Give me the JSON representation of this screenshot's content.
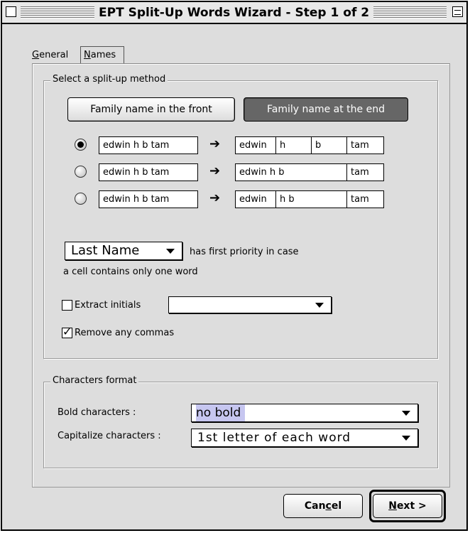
{
  "window": {
    "title": "EPT Split-Up Words Wizard - Step 1 of 2"
  },
  "tabs": [
    {
      "label_prefix": "",
      "mnemonic": "G",
      "label_rest": "eneral"
    },
    {
      "label_prefix": "",
      "mnemonic": "N",
      "label_rest": "ames"
    }
  ],
  "split_method": {
    "legend": "Select a split-up method",
    "btn_front": "Family name in the front",
    "btn_end": "Family name at the end",
    "options": [
      {
        "input": "edwin h b tam",
        "parts": [
          "edwin",
          "h",
          "b",
          "tam"
        ],
        "selected": true
      },
      {
        "input": "edwin h b tam",
        "parts": [
          "edwin h b",
          "tam"
        ],
        "selected": false
      },
      {
        "input": "edwin h b tam",
        "parts": [
          "edwin",
          "h b",
          "tam"
        ],
        "selected": false
      }
    ],
    "arrow_glyph": "➔",
    "priority_select": "Last Name",
    "priority_text_1": "has first priority in case",
    "priority_text_2": "a cell contains only one word",
    "extract_label": "Extract initials",
    "extract_value": "",
    "extract_checked": false,
    "remove_label": "Remove any commas",
    "remove_checked": true
  },
  "char_format": {
    "legend": "Characters format",
    "bold_label": "Bold characters :",
    "bold_value": "no bold",
    "cap_label": "Capitalize characters :",
    "cap_value": "1st letter of each word"
  },
  "footer": {
    "cancel": {
      "pre": "Can",
      "mn": "c",
      "post": "el"
    },
    "next": {
      "pre": "",
      "mn": "N",
      "post": "ext >"
    }
  }
}
